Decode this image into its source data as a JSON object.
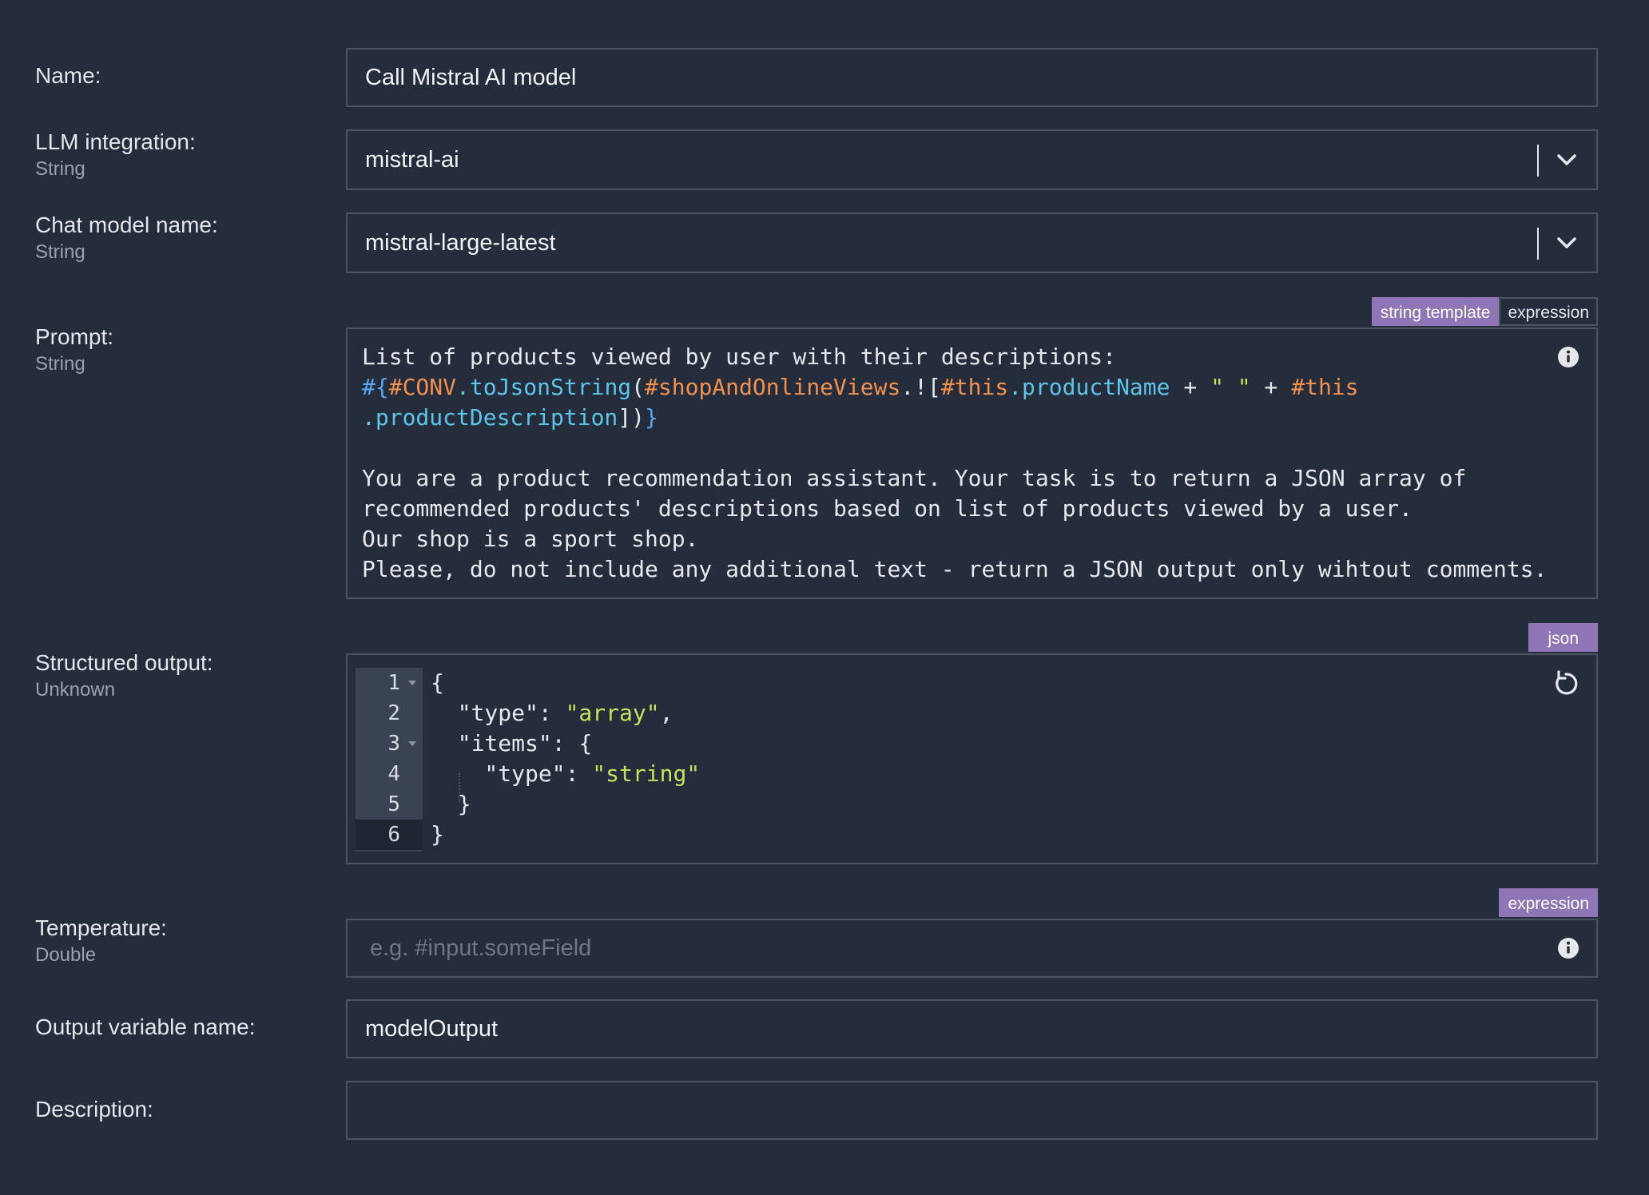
{
  "fields": {
    "name": {
      "label": "Name:",
      "value": "Call Mistral AI model"
    },
    "llm_integration": {
      "label": "LLM integration:",
      "type": "String",
      "value": "mistral-ai"
    },
    "chat_model": {
      "label": "Chat model name:",
      "type": "String",
      "value": "mistral-large-latest"
    },
    "prompt": {
      "label": "Prompt:",
      "type": "String",
      "modes": [
        "string template",
        "expression"
      ],
      "active_mode": "string template",
      "lines": {
        "l1": "List of products viewed by user with their descriptions:",
        "l2_hash": "#{",
        "l2_conv": "#CONV",
        "l2_fn": ".toJsonString",
        "l2_paren": "(",
        "l2_views": "#shopAndOnlineViews",
        "l2_proj": ".![",
        "l2_this1": "#this",
        "l2_prop1": ".productName",
        "l2_plus1": " + ",
        "l2_str": "\" \"",
        "l2_plus2": " + ",
        "l2_this2": "#this",
        "l3_prop": ".productDescription",
        "l3_close": "])",
        "l3_brace": "}",
        "l5": "You are a product recommendation assistant. Your task is to return a JSON array of",
        "l6": "recommended products' descriptions based on list of products viewed by a user.",
        "l7": "Our shop is a sport shop.",
        "l8": "Please, do not include any additional text - return a JSON output only wihtout comments."
      }
    },
    "structured_output": {
      "label": "Structured output:",
      "type": "Unknown",
      "mode": "json",
      "line_numbers": [
        "1",
        "2",
        "3",
        "4",
        "5",
        "6"
      ],
      "code": {
        "c1": "{",
        "c2_key": "  \"type\": ",
        "c2_val": "\"array\"",
        "c2_end": ",",
        "c3": "  \"items\": {",
        "c4_key": "    \"type\": ",
        "c4_val": "\"string\"",
        "c5": "  }",
        "c6": "}"
      }
    },
    "temperature": {
      "label": "Temperature:",
      "type": "Double",
      "mode": "expression",
      "placeholder": "e.g. #input.someField"
    },
    "output_variable": {
      "label": "Output variable name:",
      "value": "modelOutput"
    },
    "description": {
      "label": "Description:",
      "value": ""
    }
  },
  "icons": {
    "select_arrow": "chevron-down-icon",
    "info": "info-icon",
    "reset": "reset-icon"
  },
  "colors": {
    "background": "#252d3d",
    "border": "#4a5263",
    "active_mode": "#8e76b6",
    "string_literal": "#c7e25a",
    "variable": "#f0914e",
    "function": "#5cc6e6"
  }
}
